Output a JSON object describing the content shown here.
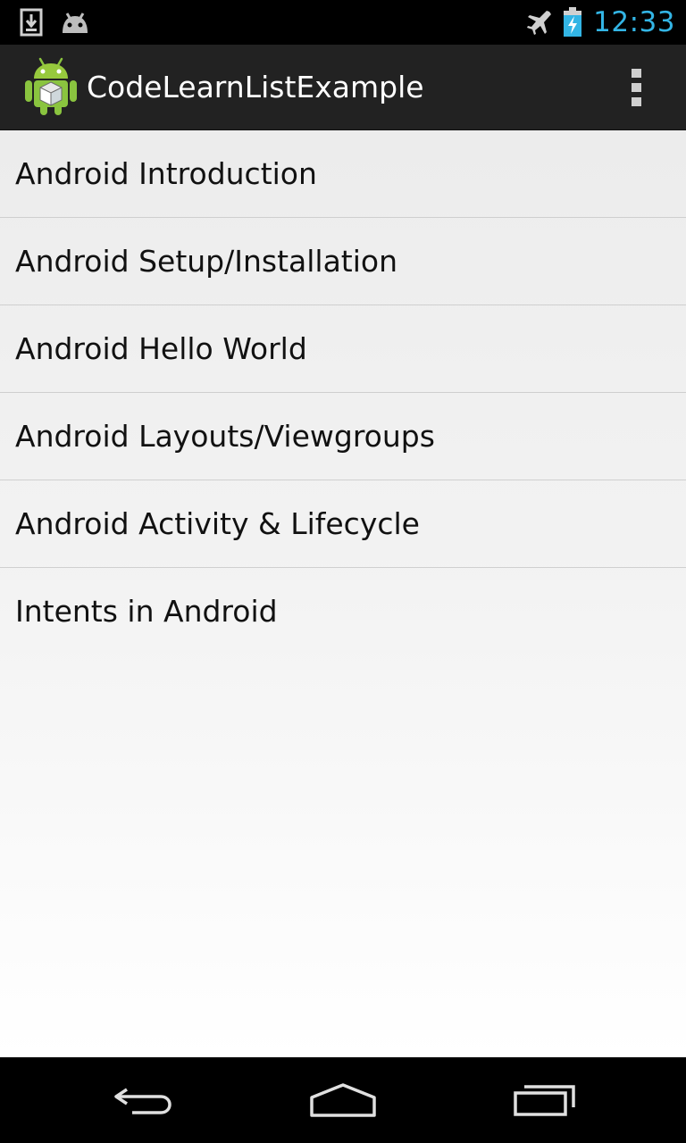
{
  "status_bar": {
    "time": "12:33",
    "icons": [
      "download-icon",
      "android-notification-icon",
      "airplane-mode-icon",
      "battery-charging-icon"
    ],
    "clock_color": "#33b5e5"
  },
  "action_bar": {
    "title": "CodeLearnListExample",
    "app_icon": "android-app-icon",
    "overflow_icon": "overflow-menu-icon",
    "background": "#222222"
  },
  "list": {
    "items": [
      {
        "label": "Android Introduction"
      },
      {
        "label": "Android Setup/Installation"
      },
      {
        "label": "Android Hello World"
      },
      {
        "label": "Android Layouts/Viewgroups"
      },
      {
        "label": "Android Activity & Lifecycle"
      },
      {
        "label": "Intents in Android"
      }
    ]
  },
  "nav_bar": {
    "buttons": [
      "back-icon",
      "home-icon",
      "recent-apps-icon"
    ]
  }
}
